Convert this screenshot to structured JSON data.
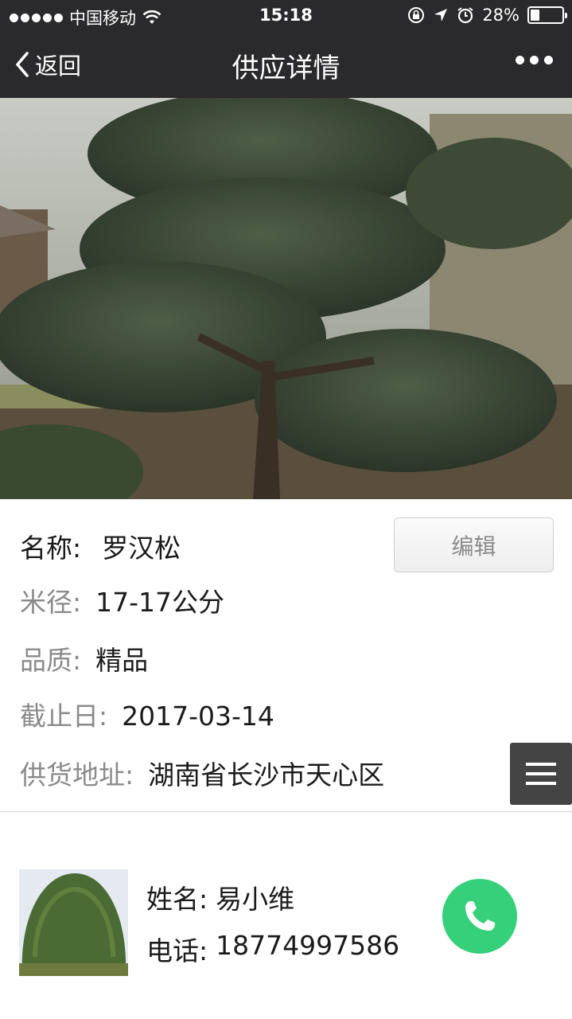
{
  "status_bar": {
    "carrier": "中国移动",
    "time": "15:18",
    "battery": "28%",
    "battery_level": 0.28
  },
  "nav": {
    "back_label": "返回",
    "title": "供应详情"
  },
  "details": {
    "name_label": "名称:",
    "name_value": "罗汉松",
    "diameter_label": "米径:",
    "diameter_value": "17-17公分",
    "quality_label": "品质:",
    "quality_value": "精品",
    "deadline_label": "截止日:",
    "deadline_value": "2017-03-14",
    "address_label": "供货地址:",
    "address_value": "湖南省长沙市天心区",
    "edit_label": "编辑"
  },
  "contact": {
    "name_label": "姓名:",
    "name_value": "易小维",
    "phone_label": "电话:",
    "phone_value": "18774997586"
  },
  "colors": {
    "bar_bg": "#2a2a2c",
    "call_green": "#36d07a",
    "menu_bg": "#444444",
    "label_gray": "#8a8a8a"
  },
  "icons": [
    "signal-dots-icon",
    "wifi-icon",
    "rotation-lock-icon",
    "location-arrow-icon",
    "alarm-icon",
    "battery-icon",
    "back-chevron-icon",
    "more-dots-icon",
    "menu-icon",
    "phone-icon"
  ]
}
